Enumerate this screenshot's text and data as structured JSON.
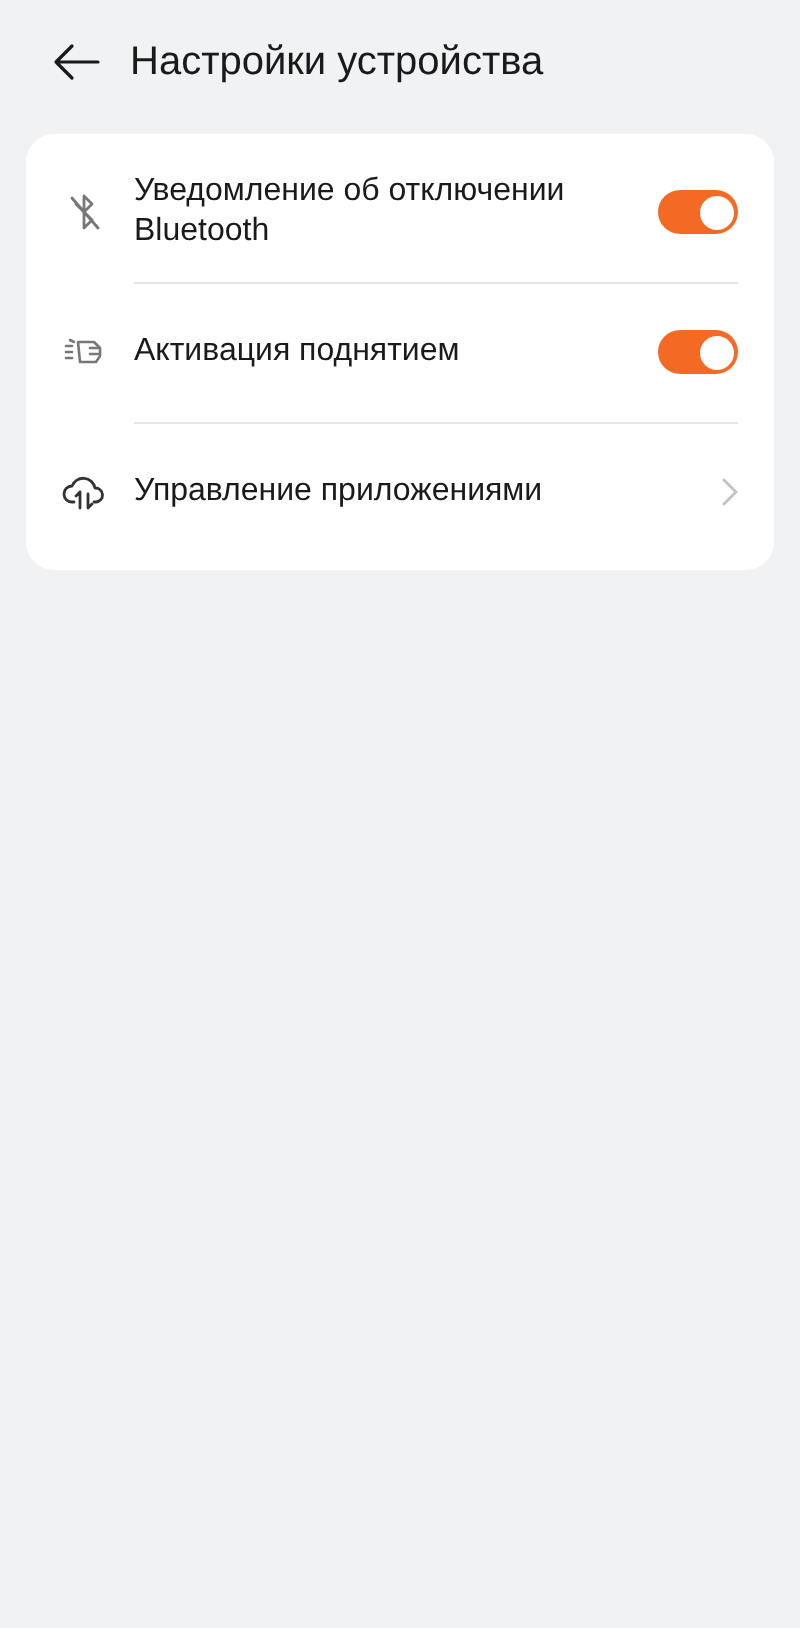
{
  "header": {
    "title": "Настройки устройства"
  },
  "items": [
    {
      "kind": "toggle",
      "label": "Уведомление об отключении Bluetooth",
      "on": true
    },
    {
      "kind": "toggle",
      "label": "Активация поднятием",
      "on": true
    },
    {
      "kind": "link",
      "label": "Управление приложениями"
    }
  ]
}
